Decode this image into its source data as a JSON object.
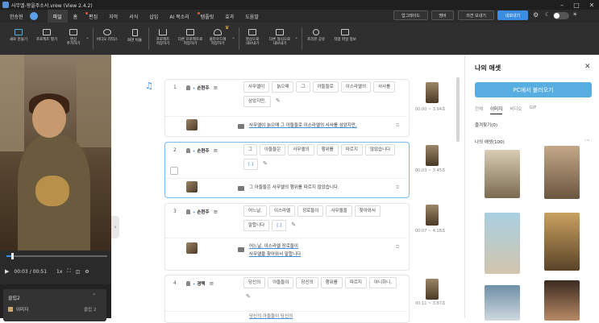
{
  "window": {
    "title": "사무엘-왕을주소서.vrew (View 2.4.2)"
  },
  "menubar": {
    "user": "한승현",
    "items": [
      {
        "label": "파일",
        "active": true,
        "dot": false
      },
      {
        "label": "홈",
        "active": false,
        "dot": false
      },
      {
        "label": "편집",
        "active": false,
        "dot": true
      },
      {
        "label": "자막",
        "active": false,
        "dot": false
      },
      {
        "label": "서식",
        "active": false,
        "dot": false
      },
      {
        "label": "삽입",
        "active": false,
        "dot": false
      },
      {
        "label": "AI 목소리",
        "active": false,
        "dot": false
      },
      {
        "label": "템플릿",
        "active": false,
        "dot": true
      },
      {
        "label": "효과",
        "active": false,
        "dot": false
      },
      {
        "label": "도움말",
        "active": false,
        "dot": false
      }
    ],
    "upgrade": "업그레이드",
    "member": "멤버",
    "feedback": "의견 보내기",
    "myvrew": "내보내기"
  },
  "toolbar": {
    "buttons": [
      {
        "label": "새로 만들기"
      },
      {
        "label": "프로젝트 열기"
      },
      {
        "label": "영상\n추가하기"
      },
      {
        "label": "비디오 리믹스"
      },
      {
        "label": "화면 비율"
      },
      {
        "label": "프로젝트\n저장하기"
      },
      {
        "label": "다른 프로젝트로\n저장하기"
      },
      {
        "label": "클라우드에\n저장하기"
      },
      {
        "label": "영상으로\n내보내기"
      },
      {
        "label": "다른 형식으로\n내보내기"
      },
      {
        "label": "프리뷰 공유"
      },
      {
        "label": "작업 파일 정보"
      }
    ]
  },
  "player": {
    "current_time": "00:03",
    "total_time": "00:51",
    "speed": "1x",
    "progress": 0.06
  },
  "clip_panel": {
    "title": "클립2",
    "row_label": "이미지",
    "row_value": "클립 2"
  },
  "scenes": [
    {
      "number": "1",
      "speaker": "손현주",
      "words": [
        "사무엘이",
        "늙으매",
        "그",
        "아들들로",
        "이스라엘의",
        "사사를",
        "삼았지만,"
      ],
      "subtitle_lines": [
        "사무엘이 늙으매 그 아들들로 이스라엘의 사사를 삼았지만,"
      ],
      "duration": "00:00 ~ 3.94초"
    },
    {
      "number": "2",
      "speaker": "손현주",
      "words": [
        "그",
        "아들들은",
        "사무엘의",
        "행위를",
        "따르지",
        "않았습니다",
        "[.]"
      ],
      "subtitle_lines": [
        "그 아들들은 사무엘의 행위를 따르지 않았습니다."
      ],
      "duration": "00:03 ~ 3.45초"
    },
    {
      "number": "3",
      "speaker": "손현주",
      "words": [
        "어느날,",
        "이스라엘",
        "장로들이",
        "사무엘을",
        "찾아와서",
        "말합니다",
        "[.]"
      ],
      "subtitle_lines": [
        "어느날, 이스라엘 장로들이",
        "사무엘을 찾아와서 말합니다"
      ],
      "duration": "00:07 ~ 4.18초"
    },
    {
      "number": "4",
      "speaker": "경택",
      "words": [
        "당신의",
        "아들들이",
        "당신의",
        "행위를",
        "따르지",
        "아니하니,"
      ],
      "subtitle_lines": [
        "당신의 아들들이 당신의"
      ],
      "duration": "00:11 ~ 3.87초"
    }
  ],
  "asset_panel": {
    "title": "나의 애셋",
    "load_button": "PC에서 불러오기",
    "tabs": [
      "전체",
      "이미지",
      "비디오",
      "GIF"
    ],
    "active_tab": "이미지",
    "favorites": "즐겨찾기(0)",
    "my_assets": "나의 애셋(100)"
  }
}
